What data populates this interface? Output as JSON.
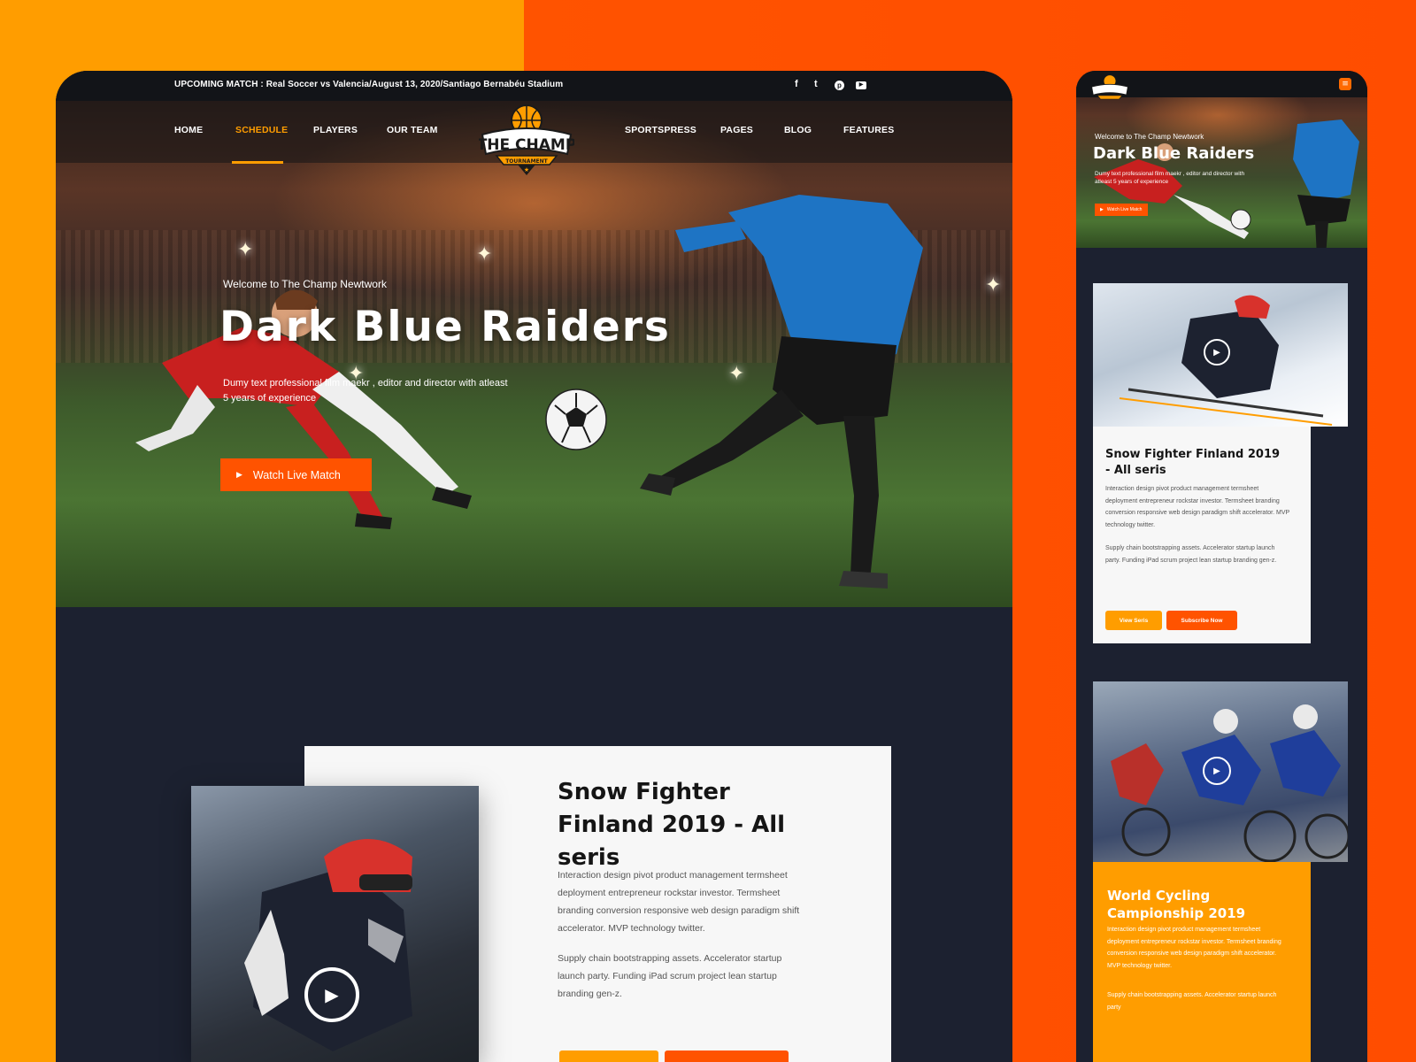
{
  "colors": {
    "accent_orange": "#ff9d00",
    "accent_red_orange": "#ff5300",
    "dark_bg": "#1c2130",
    "card_bg": "#f7f7f7"
  },
  "desktop": {
    "topbar": {
      "upcoming": "UPCOMING MATCH : Real Soccer vs Valencia/August 13, 2020/Santiago Bernabéu Stadium",
      "social_icons": [
        "facebook-icon",
        "twitter-icon",
        "pinterest-icon",
        "youtube-icon"
      ],
      "social_glyphs": [
        "f",
        "t",
        "p",
        "▶"
      ]
    },
    "nav": {
      "left": [
        "HOME",
        "SCHEDULE",
        "PLAYERS",
        "OUR TEAM"
      ],
      "right": [
        "SPORTSPRESS",
        "PAGES",
        "BLOG",
        "FEATURES"
      ],
      "active": "SCHEDULE"
    },
    "logo": {
      "title": "THE CHAMP",
      "subtitle": "TOURNAMENT"
    },
    "hero": {
      "welcome": "Welcome to The Champ Newtwork",
      "title": "Dark Blue Raiders",
      "description": "Dumy text  professional film maekr , editor and  director with atleast 5 years of experience",
      "button": "Watch Live Match"
    },
    "feature_card": {
      "title": "Snow Fighter Finland 2019 - All seris",
      "paragraph1": "Interaction design pivot product management termsheet deployment entrepreneur rockstar investor. Termsheet branding conversion responsive web design paradigm shift accelerator. MVP technology twitter.",
      "paragraph2": "Supply chain bootstrapping assets. Accelerator startup launch party. Funding iPad scrum project lean startup branding gen-z."
    }
  },
  "mobile": {
    "hero": {
      "welcome": "Welcome to The Champ Newtwork",
      "title": "Dark Blue Raiders",
      "description": "Dumy text  professional film maekr , editor and  director with atleast 5 years of experience",
      "button": "Watch Live Match"
    },
    "card1": {
      "title": "Snow Fighter Finland 2019 - All seris",
      "paragraph1": "Interaction design pivot product management termsheet deployment entrepreneur rockstar investor. Termsheet branding conversion responsive web design paradigm shift accelerator. MVP technology twitter.",
      "paragraph2": "Supply chain bootstrapping assets. Accelerator startup launch party. Funding iPad scrum project lean startup branding gen-z.",
      "button_view": "View Seris",
      "button_subscribe": "Subscribe Now"
    },
    "card2": {
      "title": "World Cycling Campionship 2019",
      "paragraph1": "Interaction design pivot product management termsheet deployment entrepreneur rockstar investor. Termsheet branding conversion responsive web design paradigm shift accelerator. MVP technology twitter.",
      "paragraph2": "Supply chain bootstrapping assets. Accelerator startup launch party"
    }
  }
}
